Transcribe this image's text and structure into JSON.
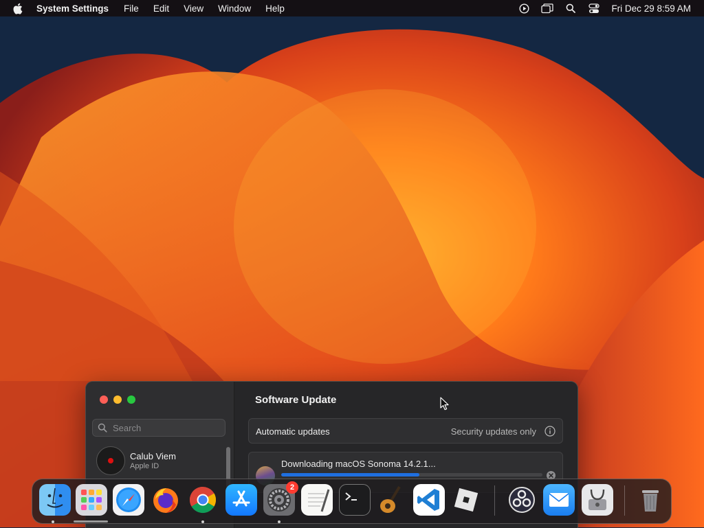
{
  "menubar": {
    "app_name": "System Settings",
    "menus": [
      "File",
      "Edit",
      "View",
      "Window",
      "Help"
    ],
    "status_icons": [
      "play-icon",
      "screen-mirroring-icon",
      "spotlight-search-icon",
      "control-center-icon"
    ],
    "clock": "Fri Dec 29  8:59 AM"
  },
  "window": {
    "title": "Software Update",
    "sidebar": {
      "search_placeholder": "Search",
      "account": {
        "name": "Calub Viem",
        "subtitle": "Apple ID"
      }
    },
    "automatic_updates": {
      "label": "Automatic updates",
      "value": "Security updates only"
    },
    "download": {
      "label": "Downloading macOS Sonoma 14.2.1...",
      "progress": 0.53
    }
  },
  "dock": {
    "items": [
      {
        "name": "finder",
        "icon": "finder-icon",
        "running": true
      },
      {
        "name": "launchpad",
        "icon": "launchpad-icon",
        "running": false
      },
      {
        "name": "safari",
        "icon": "safari-icon",
        "running": false
      },
      {
        "name": "firefox",
        "icon": "firefox-icon",
        "running": false
      },
      {
        "name": "chrome",
        "icon": "chrome-icon",
        "running": true
      },
      {
        "name": "app-store",
        "icon": "app-store-icon",
        "running": false
      },
      {
        "name": "system-settings",
        "icon": "system-settings-icon",
        "running": true,
        "badge": "2"
      },
      {
        "name": "textedit",
        "icon": "textedit-icon",
        "running": false
      },
      {
        "name": "terminal",
        "icon": "terminal-icon",
        "running": false
      },
      {
        "name": "garageband",
        "icon": "garageband-icon",
        "running": false
      },
      {
        "name": "vscode",
        "icon": "vscode-icon",
        "running": false
      },
      {
        "name": "roblox",
        "icon": "roblox-icon",
        "running": false
      },
      {
        "name": "obs",
        "icon": "obs-icon",
        "running": false
      },
      {
        "name": "mail",
        "icon": "mail-icon",
        "running": false
      },
      {
        "name": "disk-utility",
        "icon": "disk-utility-icon",
        "running": false
      },
      {
        "name": "trash",
        "icon": "trash-icon",
        "running": false
      }
    ]
  },
  "colors": {
    "accent": "#1f6fe0",
    "badge": "#ff3b30"
  }
}
